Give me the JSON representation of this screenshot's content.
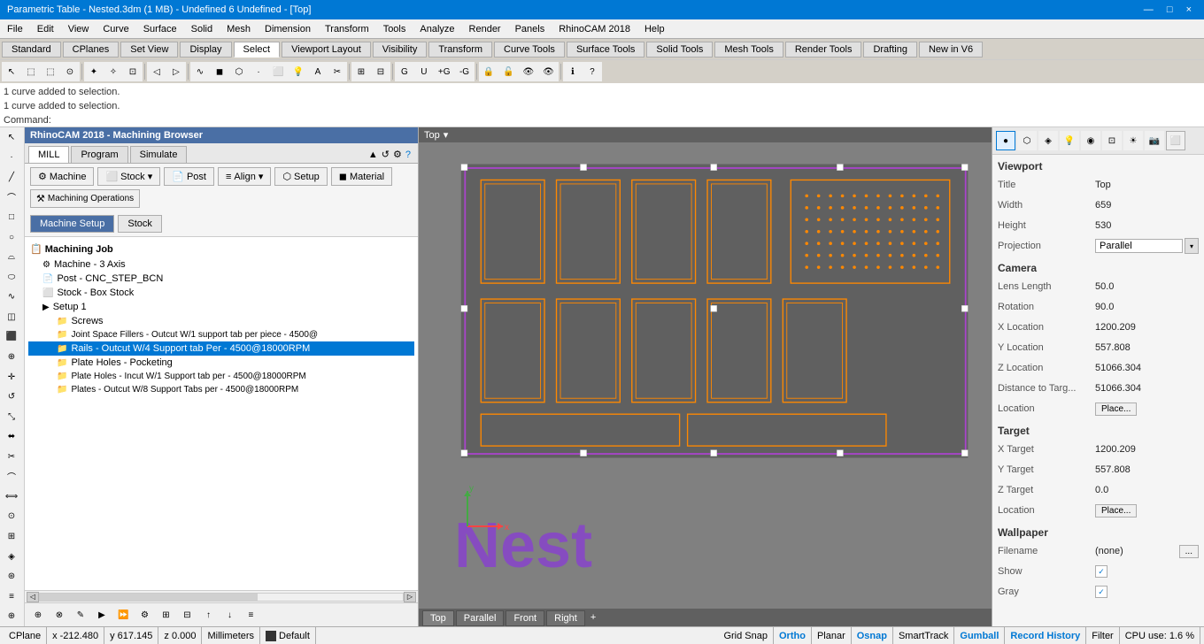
{
  "titlebar": {
    "title": "Parametric Table - Nested.3dm (1 MB) - Undefined 6 Undefined - [Top]",
    "controls": [
      "—",
      "□",
      "×"
    ]
  },
  "menubar": {
    "items": [
      "File",
      "Edit",
      "View",
      "Curve",
      "Surface",
      "Solid",
      "Mesh",
      "Dimension",
      "Transform",
      "Tools",
      "Analyze",
      "Render",
      "Panels",
      "RhinoCAM 2018",
      "Help"
    ]
  },
  "toolbar1": {
    "tabs": [
      "Standard",
      "CPlanes",
      "Set View",
      "Display",
      "Select",
      "Viewport Layout",
      "Visibility",
      "Transform",
      "Curve Tools",
      "Surface Tools",
      "Solid Tools",
      "Mesh Tools",
      "Render Tools",
      "Drafting",
      "New in V6"
    ]
  },
  "command_area": {
    "line1": "1 curve added to selection.",
    "line2": "1 curve added to selection.",
    "prompt": "Command: "
  },
  "cam_panel": {
    "title": "RhinoCAM 2018 - Machining Browser",
    "tabs": [
      "MILL",
      "Program",
      "Simulate"
    ],
    "actions": {
      "machine": "Machine",
      "post": "Post",
      "setup": "Setup",
      "stock": "Stock ▾",
      "align": "Align ▾",
      "material": "Material",
      "machining_operations": "Machining Operations"
    },
    "sections": [
      "Machine Setup",
      "Stock"
    ],
    "tree": {
      "root": "Machining Job",
      "items": [
        {
          "level": 1,
          "icon": "gear",
          "label": "Machine - 3 Axis"
        },
        {
          "level": 1,
          "icon": "post",
          "label": "Post - CNC_STEP_BCN"
        },
        {
          "level": 1,
          "icon": "box",
          "label": "Stock - Box Stock"
        },
        {
          "level": 1,
          "icon": "setup",
          "label": "Setup 1"
        },
        {
          "level": 2,
          "icon": "folder",
          "label": "Screws"
        },
        {
          "level": 2,
          "icon": "folder-op",
          "label": "Joint Space Fillers - Outcut W/1 support tab per piece - 4500@"
        },
        {
          "level": 2,
          "icon": "folder-op",
          "label": "Rails - Outcut W/4 Support tab Per - 4500@18000RPM",
          "selected": true
        },
        {
          "level": 2,
          "icon": "folder-op",
          "label": "Plate Holes - Pocketing"
        },
        {
          "level": 2,
          "icon": "folder-op",
          "label": "Plate Holes - Incut W/1 Support tab per - 4500@18000RPM"
        },
        {
          "level": 2,
          "icon": "folder-op",
          "label": "Plates - Outcut W/8 Support Tabs per - 4500@18000RPM"
        }
      ]
    }
  },
  "viewport": {
    "title": "Top",
    "dropdown_arrow": "▾",
    "tabs": [
      "Top",
      "Parallel",
      "Front",
      "Right",
      "+"
    ],
    "nest_label": "Nest",
    "axes": {
      "x": "x",
      "y": "y"
    }
  },
  "right_panel": {
    "section_viewport": "Viewport",
    "props_viewport": {
      "title": {
        "label": "Title",
        "value": "Top"
      },
      "width": {
        "label": "Width",
        "value": "659"
      },
      "height": {
        "label": "Height",
        "value": "530"
      },
      "projection": {
        "label": "Projection",
        "value": "Parallel"
      }
    },
    "section_camera": "Camera",
    "props_camera": {
      "lens_length": {
        "label": "Lens Length",
        "value": "50.0"
      },
      "rotation": {
        "label": "Rotation",
        "value": "90.0"
      },
      "x_location": {
        "label": "X Location",
        "value": "1200.209"
      },
      "y_location": {
        "label": "Y Location",
        "value": "557.808"
      },
      "z_location": {
        "label": "Z Location",
        "value": "51066.304"
      },
      "dist_to_target": {
        "label": "Distance to Targ...",
        "value": "51066.304"
      },
      "location": {
        "label": "Location",
        "btn": "Place..."
      }
    },
    "section_target": "Target",
    "props_target": {
      "x_target": {
        "label": "X Target",
        "value": "1200.209"
      },
      "y_target": {
        "label": "Y Target",
        "value": "557.808"
      },
      "z_target": {
        "label": "Z Target",
        "value": "0.0"
      },
      "location": {
        "label": "Location",
        "btn": "Place..."
      }
    },
    "section_wallpaper": "Wallpaper",
    "props_wallpaper": {
      "filename": {
        "label": "Filename",
        "value": "(none)",
        "btn": "..."
      },
      "show": {
        "label": "Show",
        "checked": true
      },
      "gray": {
        "label": "Gray",
        "checked": true
      }
    }
  },
  "statusbar": {
    "cplane": "CPlane",
    "x": "x -212.480",
    "y": "y 617.145",
    "z": "z 0.000",
    "units": "Millimeters",
    "swatch": "Default",
    "grid_snap": "Grid Snap",
    "ortho": "Ortho",
    "planar": "Planar",
    "osnap": "Osnap",
    "smart_track": "SmartTrack",
    "gumball": "Gumball",
    "record_history": "Record History",
    "filter": "Filter",
    "cpu": "CPU use: 1.6 %"
  }
}
